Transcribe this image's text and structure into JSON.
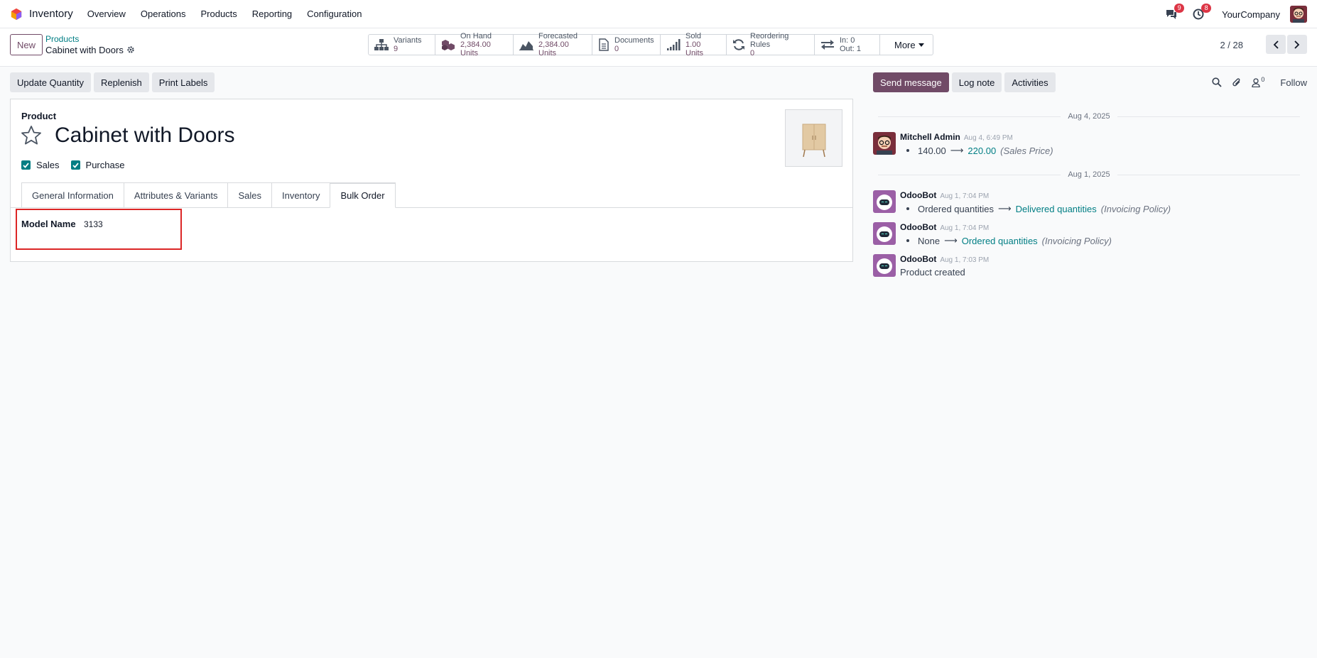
{
  "topbar": {
    "app_name": "Inventory",
    "menu": [
      "Overview",
      "Operations",
      "Products",
      "Reporting",
      "Configuration"
    ],
    "messages_count": "9",
    "activities_count": "8",
    "company": "YourCompany"
  },
  "control": {
    "new_label": "New",
    "breadcrumb_parent": "Products",
    "breadcrumb_current": "Cabinet with Doors",
    "stats": [
      {
        "label": "Variants",
        "value": "9",
        "icon": "sitemap-icon"
      },
      {
        "label": "On Hand",
        "value": "2,384.00 Units",
        "icon": "cubes-icon"
      },
      {
        "label": "Forecasted",
        "value": "2,384.00 Units",
        "icon": "area-chart-icon"
      },
      {
        "label": "Documents",
        "value": "0",
        "icon": "file-icon"
      },
      {
        "label": "Sold",
        "value": "1.00 Units",
        "icon": "signal-icon"
      },
      {
        "label": "Reordering Rules",
        "value": "0",
        "icon": "refresh-icon"
      }
    ],
    "in_out": {
      "in": "In: 0",
      "out": "Out: 1"
    },
    "more_label": "More",
    "pager": "2 / 28"
  },
  "actions": [
    "Update Quantity",
    "Replenish",
    "Print Labels"
  ],
  "form": {
    "product_label": "Product",
    "title": "Cabinet with Doors",
    "sales_label": "Sales",
    "purchase_label": "Purchase",
    "tabs": [
      "General Information",
      "Attributes & Variants",
      "Sales",
      "Inventory",
      "Bulk Order"
    ],
    "active_tab": "Bulk Order",
    "field_label": "Model Name",
    "field_value": "3133"
  },
  "chatter": {
    "send_message": "Send message",
    "log_note": "Log note",
    "activities": "Activities",
    "followers_count": "0",
    "follow": "Follow",
    "date1": "Aug 4, 2025",
    "date2": "Aug 1, 2025",
    "messages": [
      {
        "author": "Mitchell Admin",
        "date": "Aug 4, 6:49 PM",
        "old": "140.00",
        "new": "220.00",
        "field": "(Sales Price)"
      },
      {
        "author": "OdooBot",
        "date": "Aug 1, 7:04 PM",
        "old": "Ordered quantities",
        "new": "Delivered quantities",
        "field": "(Invoicing Policy)"
      },
      {
        "author": "OdooBot",
        "date": "Aug 1, 7:04 PM",
        "old": "None",
        "new": "Ordered quantities",
        "field": "(Invoicing Policy)"
      },
      {
        "author": "OdooBot",
        "date": "Aug 1, 7:03 PM",
        "body": "Product created"
      }
    ]
  },
  "colors": {
    "brand": "#714b67",
    "teal": "#017e84",
    "badge": "#dc3545",
    "highlight": "#dc2626"
  }
}
